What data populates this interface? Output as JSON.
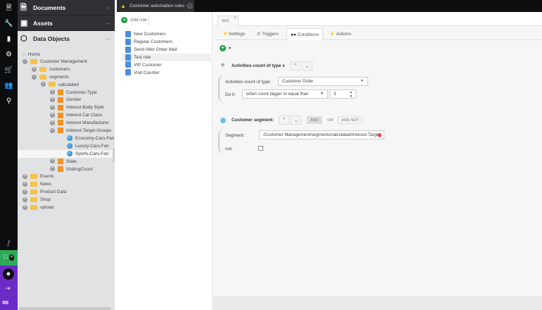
{
  "nav": {
    "icons": [
      "file-icon",
      "wrench-icon",
      "chart-icon",
      "gear-icon",
      "cart-icon",
      "users-icon",
      "search-icon"
    ],
    "notification_count": "4"
  },
  "tree": {
    "sections": [
      {
        "label": "Documents",
        "icon": "document-icon"
      },
      {
        "label": "Assets",
        "icon": "camera-icon"
      },
      {
        "label": "Data Objects",
        "icon": "cube-icon"
      }
    ],
    "items": [
      {
        "label": "Home",
        "level": 0,
        "type": "home",
        "toggle": ""
      },
      {
        "label": "Customer Management",
        "level": 0,
        "type": "folder",
        "toggle": "-"
      },
      {
        "label": "customers",
        "level": 1,
        "type": "folder",
        "toggle": "+"
      },
      {
        "label": "segments",
        "level": 1,
        "type": "folder",
        "toggle": "-"
      },
      {
        "label": "calculated",
        "level": 2,
        "type": "folder",
        "toggle": "-"
      },
      {
        "label": "Customer-Type",
        "level": 3,
        "type": "object",
        "toggle": "+"
      },
      {
        "label": "Gender",
        "level": 3,
        "type": "object",
        "toggle": "+"
      },
      {
        "label": "Interest Body Style",
        "level": 3,
        "type": "object",
        "toggle": "+"
      },
      {
        "label": "Interest Car Class",
        "level": 3,
        "type": "object",
        "toggle": "+"
      },
      {
        "label": "Interest Manufacturer",
        "level": 3,
        "type": "object",
        "toggle": "+"
      },
      {
        "label": "Interest-Target-Groups",
        "level": 3,
        "type": "object",
        "toggle": "-"
      },
      {
        "label": "Economy-Cars-Fan",
        "level": 4,
        "type": "segment",
        "toggle": ""
      },
      {
        "label": "Luxury-Cars-Fan",
        "level": 4,
        "type": "segment",
        "toggle": ""
      },
      {
        "label": "Sports-Cars-Fan",
        "level": 4,
        "type": "segment",
        "toggle": "",
        "selected": true
      },
      {
        "label": "State",
        "level": 3,
        "type": "object",
        "toggle": "+"
      },
      {
        "label": "VisitingCount",
        "level": 3,
        "type": "object",
        "toggle": "+"
      },
      {
        "label": "Events",
        "level": 0,
        "type": "folder",
        "toggle": "+"
      },
      {
        "label": "News",
        "level": 0,
        "type": "folder",
        "toggle": "+"
      },
      {
        "label": "Product Data",
        "level": 0,
        "type": "folder",
        "toggle": "+"
      },
      {
        "label": "Shop",
        "level": 0,
        "type": "folder",
        "toggle": "+"
      },
      {
        "label": "upload",
        "level": 0,
        "type": "folder",
        "toggle": "+"
      }
    ]
  },
  "main_tab": {
    "label": "Customer automation rules"
  },
  "rules": {
    "add_label": "Add rule",
    "items": [
      "New Customers",
      "Regular Customers",
      "Send After Order Mail",
      "Test rule",
      "VIP Customer",
      "Visit Counter"
    ],
    "selected": "Test rule"
  },
  "editor": {
    "tab": "test",
    "tabs": [
      "Settings",
      "Triggers",
      "Conditions",
      "Actions"
    ],
    "active_tab": "Conditions",
    "cond1": {
      "title": "Activities count of type x",
      "type_label": "Activities count of type:",
      "type_value": "Customer Order",
      "doit_label": "Do it:",
      "doit_value": "when count bigger or equal than",
      "count": "3"
    },
    "cond2": {
      "title": "Customer segment:",
      "ops": [
        "AND",
        "OR",
        "AND NOT"
      ],
      "active_op": "AND",
      "segment_label": "Segment:",
      "segment_value": "/Customer Management/segments/calculated/Interest-Target",
      "not_label": "not:",
      "not_checked": false
    }
  }
}
